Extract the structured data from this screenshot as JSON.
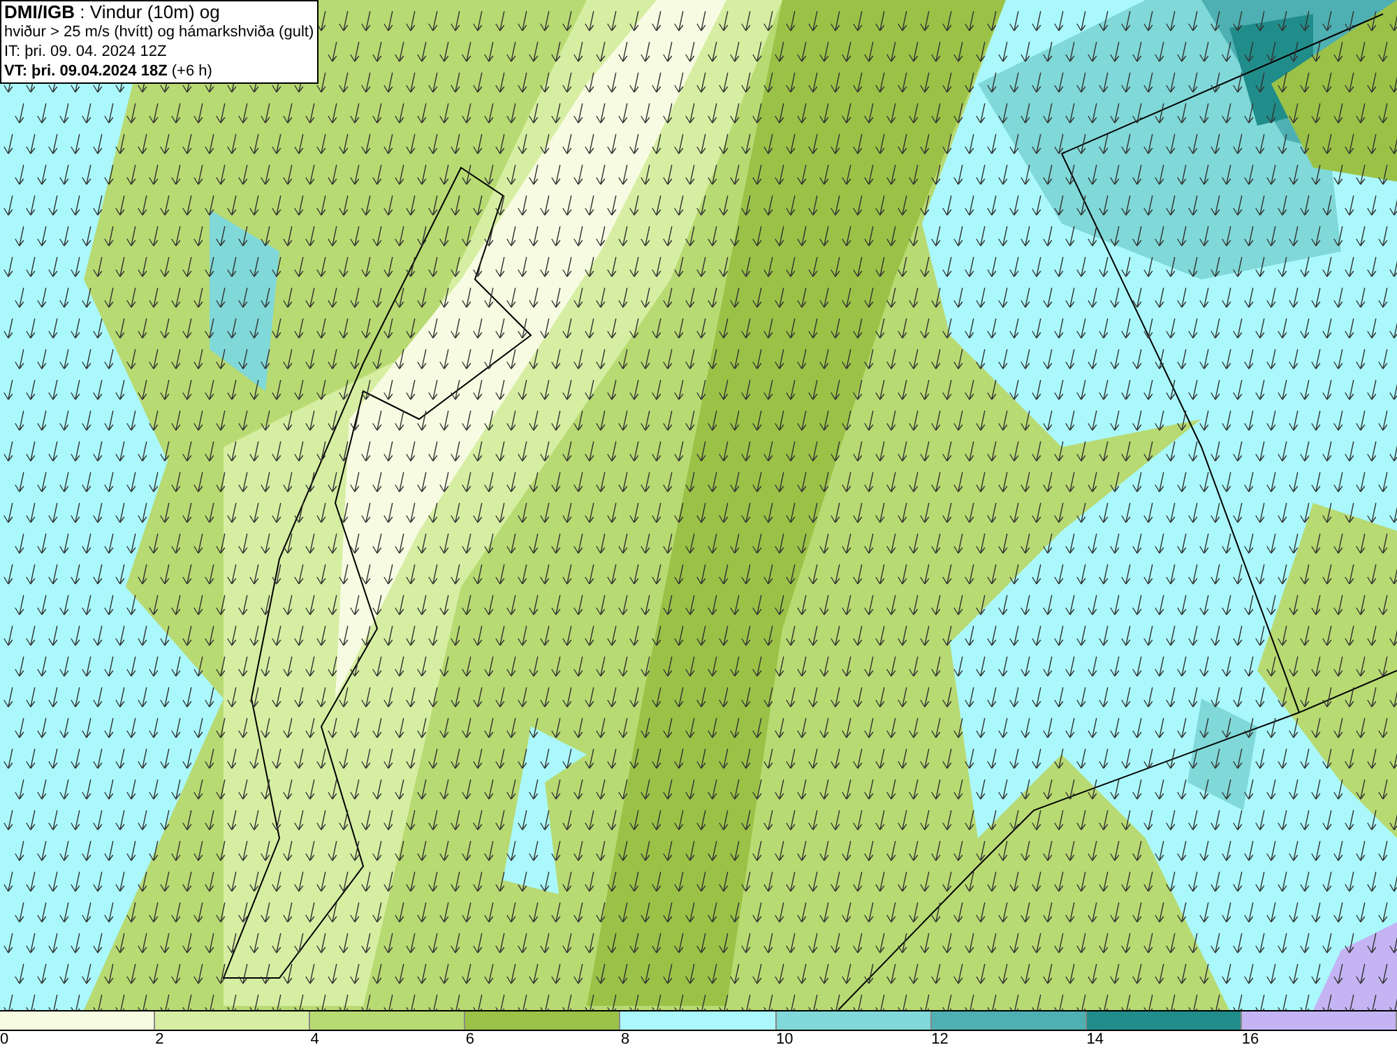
{
  "title_box": {
    "lines": [
      "**DMI/IGB** : Vindur (10m) og",
      "hviður > 25 m/s (hvítt) og hámarkshviða (gult)",
      "IT: þri. 09. 04. 2024 12Z",
      "**VT: þri. 09.04.2024 18Z** (+6 h)"
    ]
  },
  "legend": {
    "bins": [
      {
        "color": "#f7fbe1"
      },
      {
        "color": "#d6eea2"
      },
      {
        "color": "#b8da72"
      },
      {
        "color": "#9bc247"
      },
      {
        "color": "#aaf8fb"
      },
      {
        "color": "#80d8d8"
      },
      {
        "color": "#4eb0b2"
      },
      {
        "color": "#218d8a"
      },
      {
        "color": "#c4b4f4"
      }
    ],
    "ticks": [
      "0",
      "2",
      "4",
      "6",
      "8",
      "10",
      "12",
      "14",
      "16"
    ]
  }
}
